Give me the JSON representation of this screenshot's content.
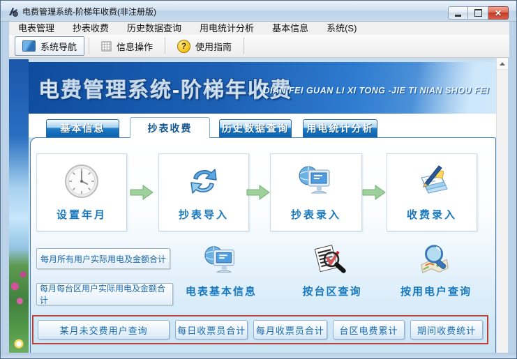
{
  "window": {
    "title": "电费管理系统-阶梯年收费(非注册版)"
  },
  "menu_bar": {
    "items": [
      "电表管理",
      "抄表收费",
      "历史数据查询",
      "用电统计分析",
      "基本信息",
      "系统(S)"
    ]
  },
  "toolbar": {
    "nav": "系统导航",
    "info": "信息操作",
    "guide": "使用指南"
  },
  "icons": {
    "help_glyph": "?",
    "close_glyph": "✕"
  },
  "banner": {
    "title": "电费管理系统-阶梯年收费",
    "subtitle": "DIAN FEI GUAN LI XI TONG -JIE TI NIAN SHOU FEI"
  },
  "tabs": {
    "basic": "基本信息",
    "reading": "抄表收费",
    "history": "历史数据查询",
    "stats": "用电统计分析"
  },
  "workflow": {
    "step1": "设置年月",
    "step2": "抄表导入",
    "step3": "抄表录入",
    "step4": "收费录入"
  },
  "summary": {
    "btn1": "每月所有用户实际用电及金额合计",
    "btn2": "每月每台区用户实际用电及金额合计"
  },
  "queries": {
    "meter_info": "电表基本信息",
    "by_area": "按台区查询",
    "by_user": "按用电户查询"
  },
  "reports": {
    "btn1": "某月未交费用户查询",
    "btn2": "每日收票员合计",
    "btn3": "每月收票员合计",
    "btn4": "台区电费累计",
    "btn5": "期间收费统计"
  },
  "colors": {
    "banner_blue": "#1a5cb0",
    "tab_blue": "#1272c2",
    "accent_text": "#1b6cae",
    "highlight_red": "#b5413a",
    "arrow_green": "#9ed09c"
  }
}
